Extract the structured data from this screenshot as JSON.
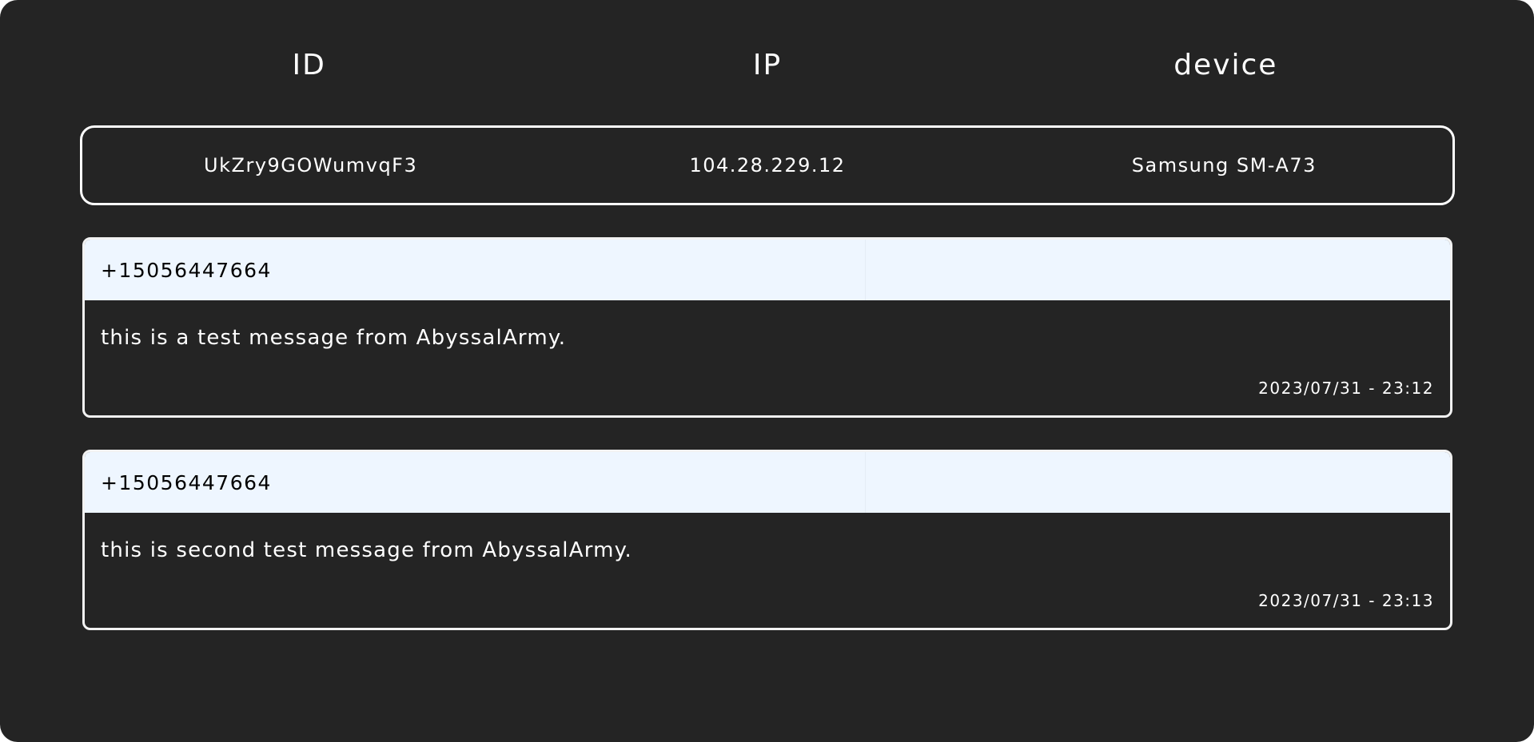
{
  "header": {
    "id_label": "ID",
    "ip_label": "IP",
    "device_label": "device"
  },
  "client": {
    "id": "UkZry9GOWumvqF3",
    "ip": "104.28.229.12",
    "device": "Samsung SM-A73"
  },
  "messages": [
    {
      "sender": "+15056447664",
      "text": "this is a test message from AbyssalArmy.",
      "timestamp": "2023/07/31 - 23:12"
    },
    {
      "sender": "+15056447664",
      "text": "this is second test message from AbyssalArmy.",
      "timestamp": "2023/07/31 - 23:13"
    }
  ],
  "colors": {
    "background": "#242424",
    "text": "#ffffff",
    "message_header": "#eef6ff",
    "border": "#ffffff"
  }
}
